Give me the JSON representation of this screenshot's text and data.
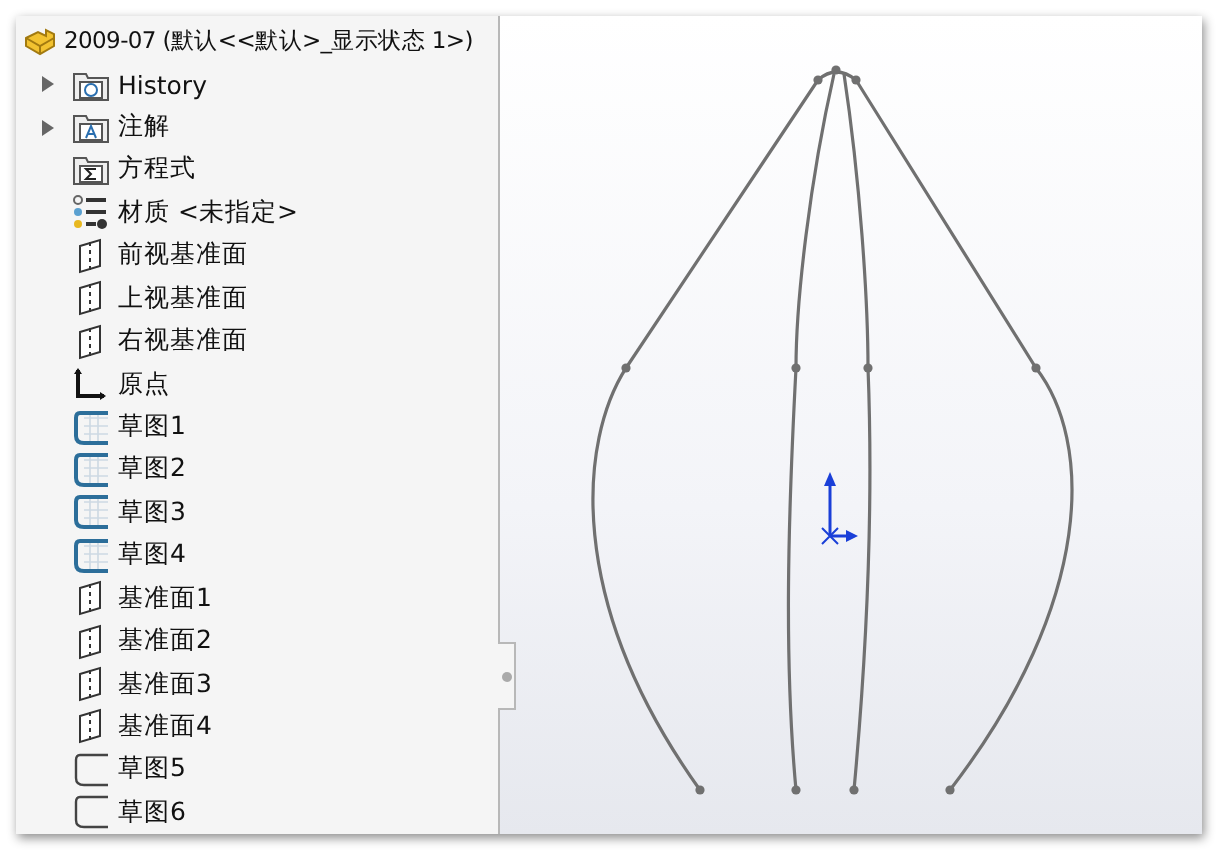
{
  "tree": {
    "root": {
      "label": "2009-07  (默认<<默认>_显示状态 1>)",
      "kind": "part"
    },
    "items": [
      {
        "label": "History",
        "kind": "history-folder",
        "expandable": true
      },
      {
        "label": "注解",
        "kind": "annotation-folder",
        "expandable": true
      },
      {
        "label": "方程式",
        "kind": "equation-folder",
        "expandable": false
      },
      {
        "label": "材质 <未指定>",
        "kind": "material",
        "expandable": false
      },
      {
        "label": "前视基准面",
        "kind": "plane",
        "expandable": false
      },
      {
        "label": "上视基准面",
        "kind": "plane",
        "expandable": false
      },
      {
        "label": "右视基准面",
        "kind": "plane",
        "expandable": false
      },
      {
        "label": "原点",
        "kind": "origin",
        "expandable": false
      },
      {
        "label": "草图1",
        "kind": "sketch-used",
        "expandable": false
      },
      {
        "label": "草图2",
        "kind": "sketch-used",
        "expandable": false
      },
      {
        "label": "草图3",
        "kind": "sketch-used",
        "expandable": false
      },
      {
        "label": "草图4",
        "kind": "sketch-used",
        "expandable": false
      },
      {
        "label": "基准面1",
        "kind": "plane",
        "expandable": false
      },
      {
        "label": "基准面2",
        "kind": "plane",
        "expandable": false
      },
      {
        "label": "基准面3",
        "kind": "plane",
        "expandable": false
      },
      {
        "label": "基准面4",
        "kind": "plane",
        "expandable": false
      },
      {
        "label": "草图5",
        "kind": "sketch",
        "expandable": false
      },
      {
        "label": "草图6",
        "kind": "sketch",
        "expandable": false
      }
    ]
  }
}
